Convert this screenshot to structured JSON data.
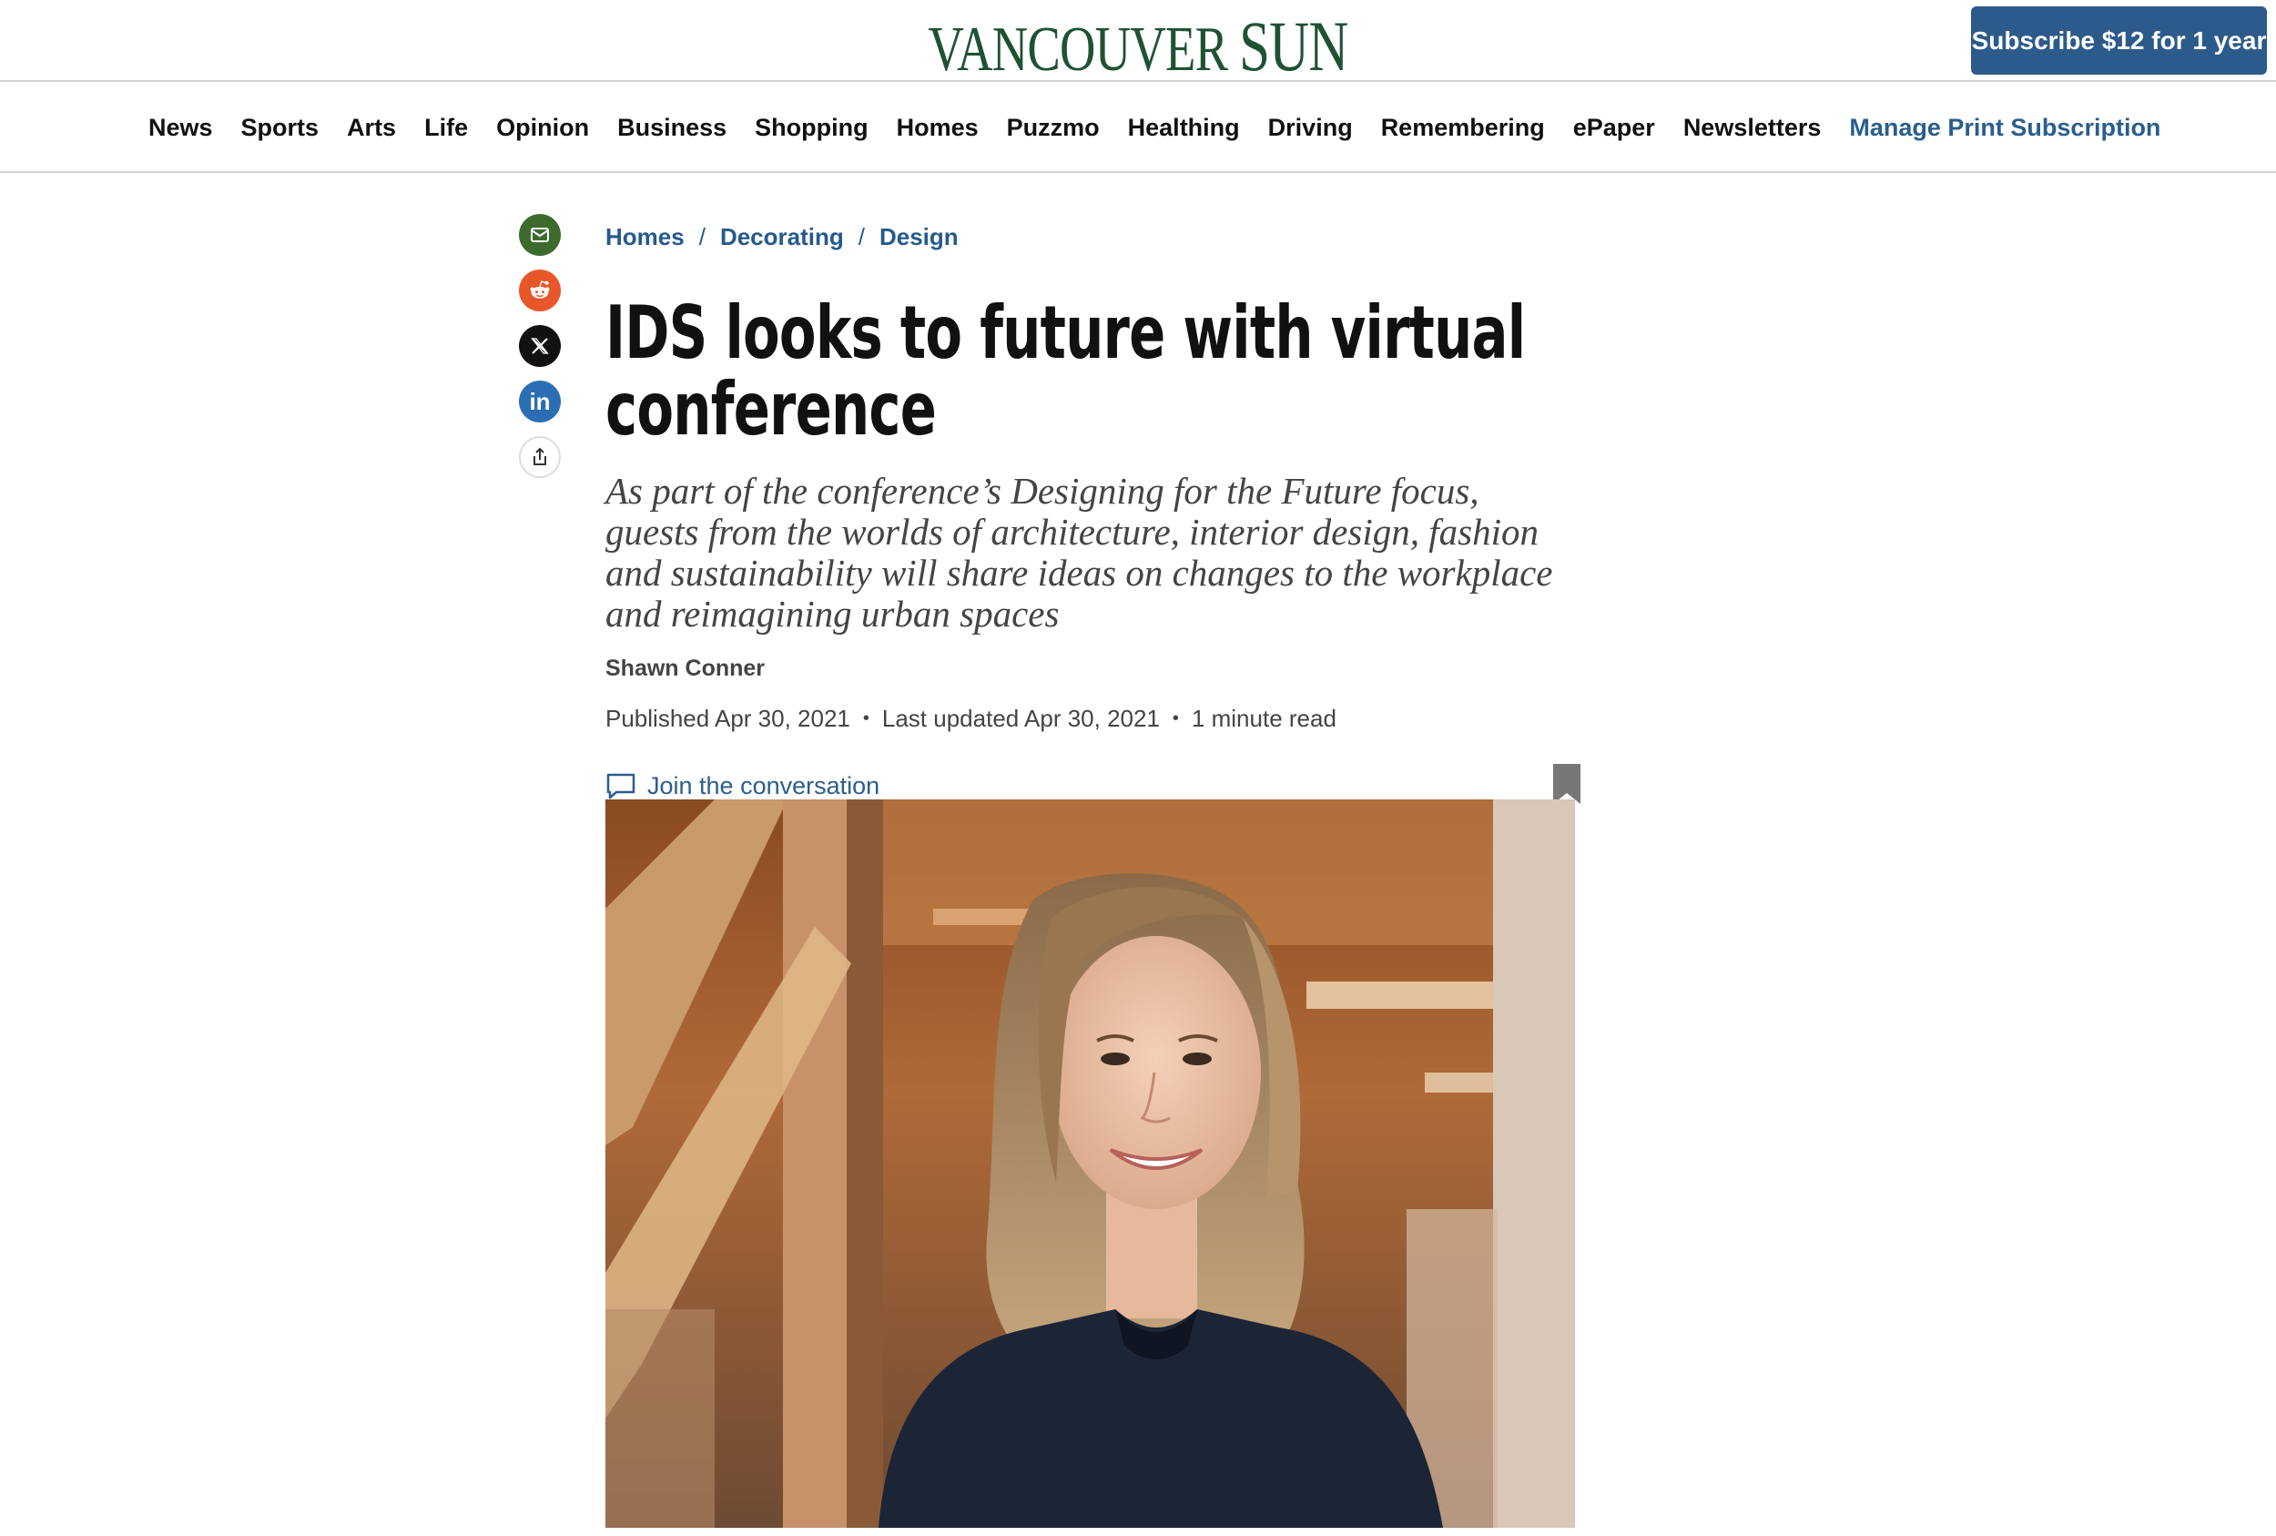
{
  "header": {
    "logo_first": "VANCOUVER",
    "logo_second": "SUN",
    "subscribe_label": "Subscribe $12 for 1 year"
  },
  "nav": {
    "items": [
      "News",
      "Sports",
      "Arts",
      "Life",
      "Opinion",
      "Business",
      "Shopping",
      "Homes",
      "Puzzmo",
      "Healthing",
      "Driving",
      "Remembering",
      "ePaper",
      "Newsletters"
    ],
    "manage_label": "Manage Print Subscription"
  },
  "share": {
    "icons": [
      "email-icon",
      "reddit-icon",
      "x-icon",
      "linkedin-icon",
      "share-icon"
    ],
    "linkedin_text": "in"
  },
  "article": {
    "breadcrumbs": [
      "Homes",
      "Decorating",
      "Design"
    ],
    "breadcrumb_separator": "/",
    "headline": "IDS looks to future with virtual conference",
    "dek": "As part of the conference’s Designing for the Future focus, guests from the worlds of architecture, interior design, fashion and sustainability will share ideas on changes to the workplace and reimagining urban spaces",
    "author": "Shawn Conner",
    "published": "Published Apr 30, 2021",
    "updated": "Last updated Apr 30, 2021",
    "read_time": "1 minute read",
    "meta_separator": "•",
    "join_label": "Join the conversation"
  },
  "colors": {
    "brand_green": "#1f5233",
    "link_blue": "#2a5e8f",
    "subscribe_bg": "#2c5a8a"
  }
}
